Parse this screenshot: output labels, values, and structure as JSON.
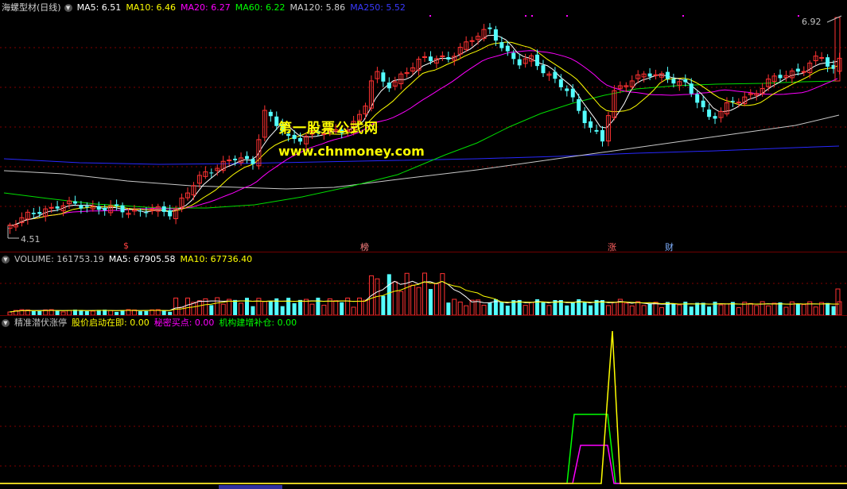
{
  "main": {
    "title": "海螺型材(日线)",
    "ma": [
      {
        "label": "MA5: 6.51",
        "color": "#ffffff"
      },
      {
        "label": "MA10: 6.46",
        "color": "#ffff00"
      },
      {
        "label": "MA20: 6.27",
        "color": "#ff00ff"
      },
      {
        "label": "MA60: 6.22",
        "color": "#00ff00"
      },
      {
        "label": "MA120: 5.86",
        "color": "#d0d0d0"
      },
      {
        "label": "MA250: 5.52",
        "color": "#3030ff"
      }
    ],
    "high_label": "6.92",
    "low_label": "4.51",
    "markers": [
      "$",
      "榜",
      "涨",
      "财"
    ]
  },
  "watermark": {
    "line1": "第一股票公式网",
    "line2": "www.chnmoney.com"
  },
  "volume": {
    "label": "VOLUME: 161753.19",
    "ma5": "MA5: 67905.58",
    "ma10": "MA10: 67736.40"
  },
  "indicator": {
    "name": "精准潜伏涨停",
    "s1": "股价启动在即: 0.00",
    "s2": "秘密买点: 0.00",
    "s3": "机构建增补仓: 0.00"
  },
  "colors": {
    "up": "#ff3232",
    "down": "#54ffff",
    "grid": "#800000"
  }
}
